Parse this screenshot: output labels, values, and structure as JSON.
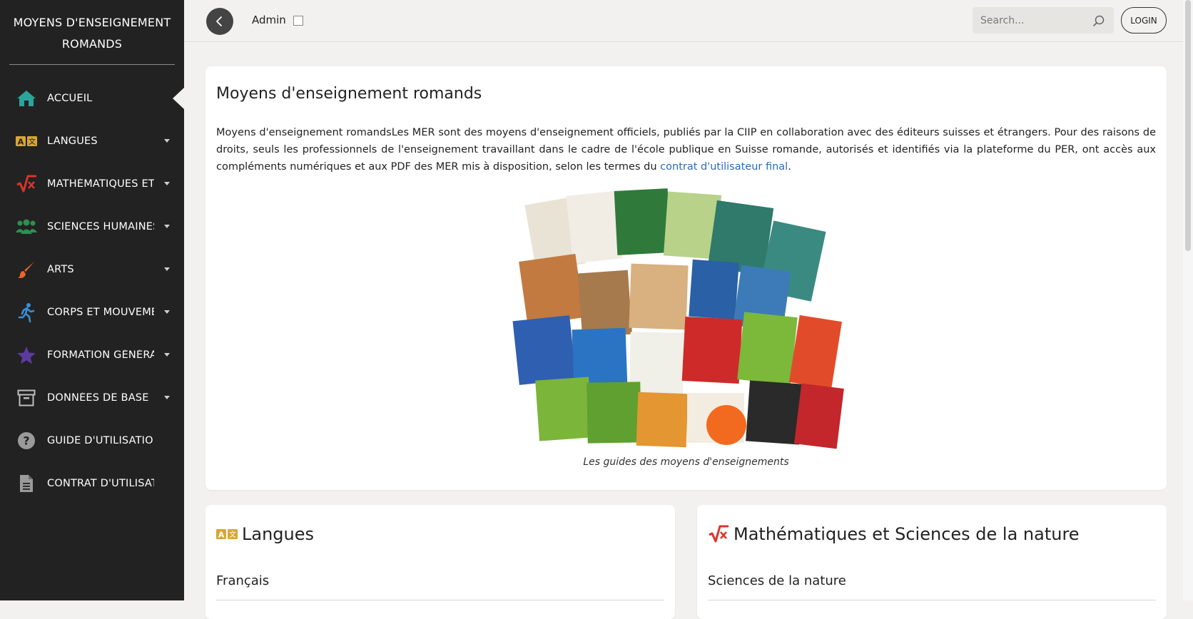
{
  "brand": {
    "line1": "MOYENS D'ENSEIGNEMENT",
    "line2": "ROMANDS"
  },
  "sidebar": {
    "items": [
      {
        "label": "ACCUEIL",
        "icon": "home-icon",
        "active": true
      },
      {
        "label": "LANGUES",
        "icon": "letters-icon",
        "has_caret": true
      },
      {
        "label": "MATHÉMATIQUES ET",
        "icon": "math-sqrt-icon",
        "has_caret": true
      },
      {
        "label": "SCIENCES HUMAINES",
        "icon": "people-icon",
        "has_caret": true
      },
      {
        "label": "ARTS",
        "icon": "paintbrush-icon",
        "has_caret": true
      },
      {
        "label": "CORPS ET MOUVEME",
        "icon": "running-person-icon",
        "has_caret": true
      },
      {
        "label": "FORMATION GÉNÉRA",
        "icon": "star-icon",
        "has_caret": true
      },
      {
        "label": "DONNÉES DE BASE",
        "icon": "archive-box-icon",
        "has_caret": true
      },
      {
        "label": "GUIDE D'UTILISATION",
        "icon": "question-circle-icon"
      },
      {
        "label": "CONTRAT D'UTILISAT",
        "icon": "document-icon"
      }
    ]
  },
  "topbar": {
    "admin_label": "Admin",
    "search_placeholder": "Search...",
    "login_label": "LOGIN"
  },
  "main": {
    "title": "Moyens d'enseignement romands",
    "intro_text": "Moyens d'enseignement romandsLes MER sont des moyens d'enseignement officiels, publiés par la CIIP en collaboration avec des éditeurs suisses et étrangers. Pour des raisons de droits, seuls les professionnels de l'enseignement travaillant dans le cadre de l'école publique en Suisse romande, autorisés et identifiés via la plateforme du PER, ont accès aux compléments numériques et aux PDF des MER mis à disposition, selon les termes du ",
    "intro_link": "contrat d'utilisateur final",
    "intro_end": ".",
    "figure_caption": "Les guides des moyens d'enseignements"
  },
  "sections": [
    {
      "title": "Langues",
      "icon": "letters-icon",
      "subtitle": "Français"
    },
    {
      "title": "Mathématiques et Sciences de la nature",
      "icon": "math-sqrt-icon",
      "subtitle": "Sciences de la nature"
    }
  ],
  "colors": {
    "sidebar_bg": "#222222",
    "accent_teal": "#2aa59a",
    "accent_gold": "#d8a634",
    "accent_red": "#d9342b",
    "accent_orange": "#e8652a",
    "accent_purple": "#5b3b9e",
    "link": "#2f6ab5"
  }
}
